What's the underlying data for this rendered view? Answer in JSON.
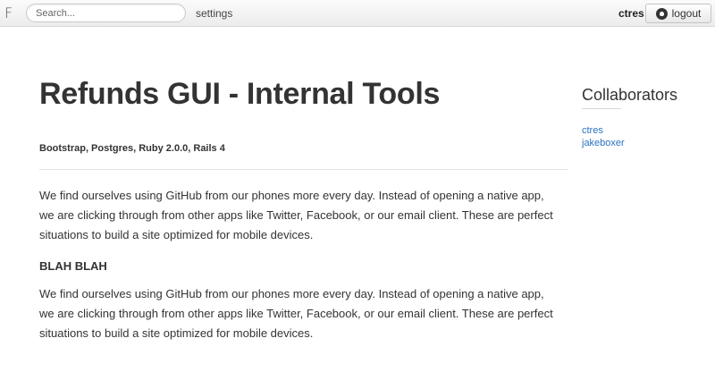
{
  "topbar": {
    "logo": "F",
    "search_placeholder": "Search...",
    "settings_label": "settings",
    "username": "ctres",
    "logout_label": "logout"
  },
  "project": {
    "title": "Refunds GUI - Internal Tools",
    "tech_stack": "Bootstrap, Postgres, Ruby 2.0.0, Rails 4",
    "paragraph1": "We find ourselves using GitHub from our phones more every day. Instead of opening a native app, we are clicking through from other apps like Twitter, Facebook, or our email client. These are perfect situations to build a site optimized for mobile devices.",
    "subheading": "BLAH BLAH",
    "paragraph2": "We find ourselves using GitHub from our phones more every day. Instead of opening a native app, we are clicking through from other apps like Twitter, Facebook, or our email client. These are perfect situations to build a site optimized for mobile devices."
  },
  "sidebar": {
    "title": "Collaborators",
    "collaborators": [
      "ctres",
      "jakeboxer"
    ]
  },
  "colors": {
    "link": "#2a73c1",
    "text": "#333333"
  }
}
